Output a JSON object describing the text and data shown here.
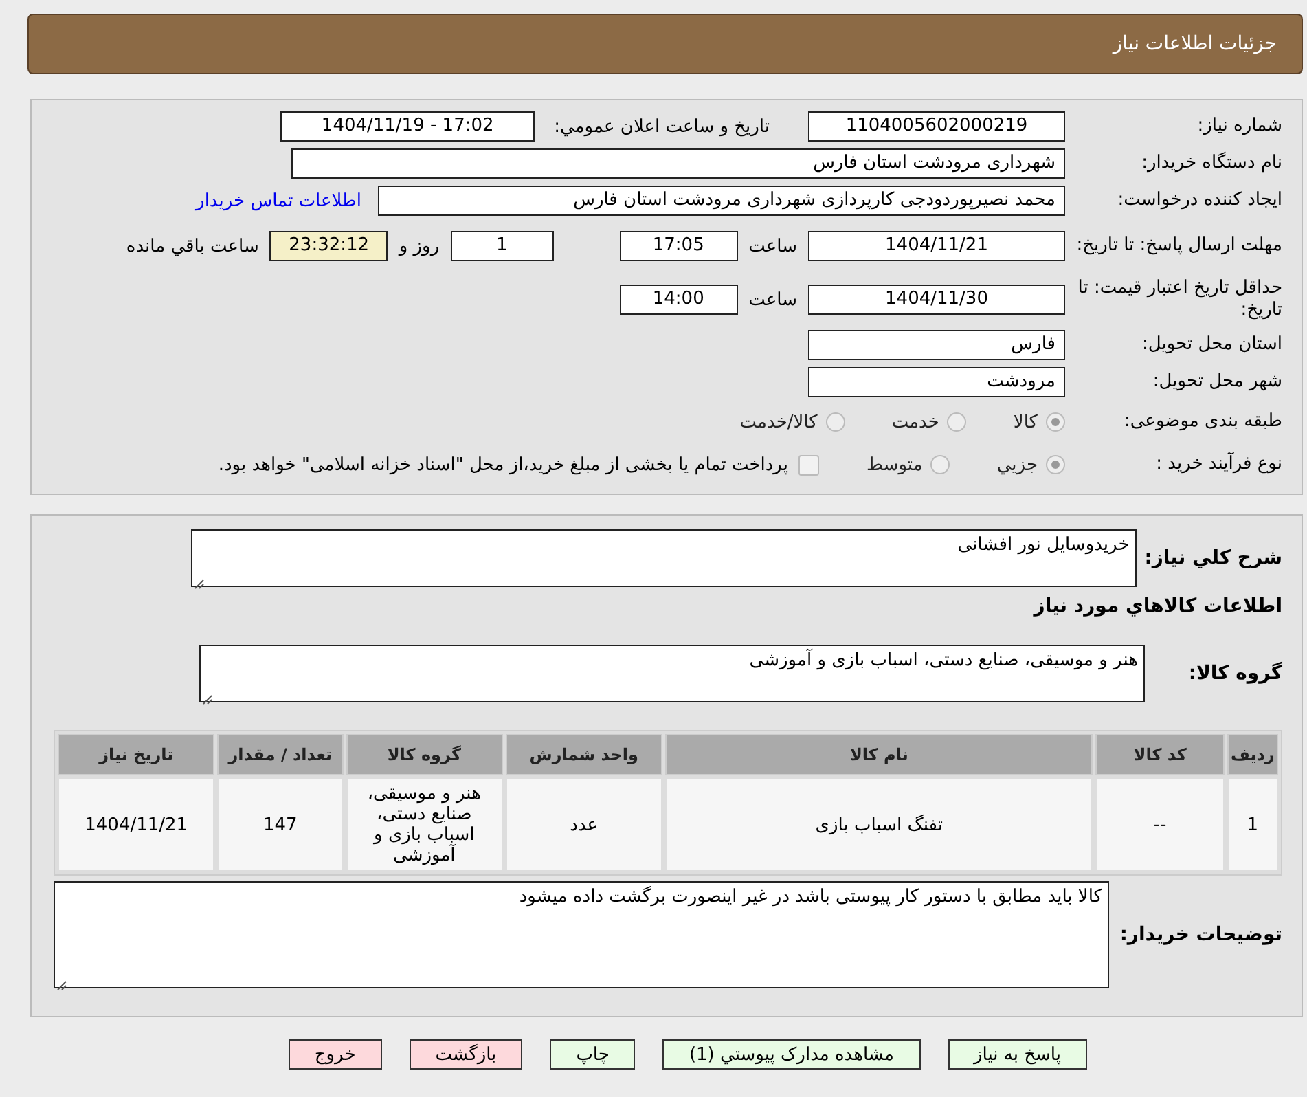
{
  "header": {
    "title": "جزئیات اطلاعات نیاز"
  },
  "form": {
    "need_number": {
      "label": "شماره نیاز:",
      "value": "1104005602000219"
    },
    "announce": {
      "label": "تاریخ و ساعت اعلان عمومي:",
      "value": "1404/11/19 - 17:02"
    },
    "buyer": {
      "label": "نام دستگاه خریدار:",
      "value": "شهرداری مرودشت استان فارس"
    },
    "creator": {
      "label": "ایجاد کننده درخواست:",
      "value": "محمد نصیرپوردودجی کارپردازی شهرداری مرودشت استان فارس",
      "link": "اطلاعات تماس خریدار"
    },
    "deadline": {
      "label": "مهلت ارسال پاسخ: تا تاریخ:",
      "date": "1404/11/21",
      "time_label": "ساعت",
      "time": "17:05",
      "days": "1",
      "days_label": "روز و",
      "remaining": "23:32:12",
      "remaining_label": "ساعت باقي مانده"
    },
    "validity": {
      "label": "حداقل تاریخ اعتبار قیمت: تا تاریخ:",
      "date": "1404/11/30",
      "time_label": "ساعت",
      "time": "14:00"
    },
    "province": {
      "label": "استان محل تحویل:",
      "value": "فارس"
    },
    "city": {
      "label": "شهر محل تحویل:",
      "value": "مرودشت"
    },
    "category": {
      "label": "طبقه بندی موضوعی:",
      "options": [
        {
          "label": "کالا",
          "selected": true
        },
        {
          "label": "خدمت",
          "selected": false
        },
        {
          "label": "کالا/خدمت",
          "selected": false
        }
      ]
    },
    "process": {
      "label": "نوع فرآیند خرید :",
      "options": [
        {
          "label": "جزيي",
          "selected": true
        },
        {
          "label": "متوسط",
          "selected": false
        }
      ],
      "payment": {
        "label": "پرداخت تمام یا بخشی از مبلغ خرید،از محل \"اسناد خزانه اسلامی\" خواهد بود.",
        "checked": false
      }
    }
  },
  "goods": {
    "description": {
      "label": "شرح کلي نیاز:",
      "value": "خریدوسایل نور افشانی"
    },
    "section_title": "اطلاعات کالاهاي مورد نیاز",
    "group": {
      "label": "گروه کالا:",
      "value": "هنر و موسیقی، صنایع دستی، اسباب بازی و آموزشی"
    },
    "table": {
      "columns": [
        "ردیف",
        "کد کالا",
        "نام کالا",
        "واحد شمارش",
        "گروه کالا",
        "تعداد / مقدار",
        "تاریخ نیاز"
      ],
      "rows": [
        [
          "1",
          "--",
          "تفنگ اسباب بازی",
          "عدد",
          "هنر و موسیقی، صنایع دستی، اسباب بازی و آموزشی",
          "147",
          "1404/11/21"
        ]
      ]
    },
    "notes": {
      "label": "توضیحات خریدار:",
      "value": "کالا باید مطابق با دستور کار پیوستی باشد در غیر اینصورت برگشت داده میشود"
    }
  },
  "buttons": [
    {
      "label": "پاسخ به نیاز",
      "kind": "primary"
    },
    {
      "label": "مشاهده مدارک پیوستي (1)",
      "kind": "primary"
    },
    {
      "label": "چاپ",
      "kind": "primary"
    },
    {
      "label": "بازگشت",
      "kind": "danger"
    },
    {
      "label": "خروج",
      "kind": "danger"
    }
  ]
}
